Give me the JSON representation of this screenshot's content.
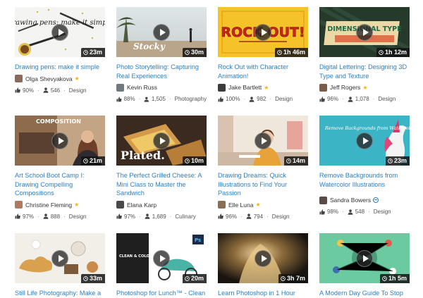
{
  "courses": [
    {
      "title": "Drawing pens: make it simple",
      "thumb_text": "Drawing pens: make it simple",
      "duration": "23m",
      "teacher": "Olga Shevyakova",
      "teacher_badge": "star",
      "rating": "90%",
      "students": "546",
      "category": "Design"
    },
    {
      "title": "Photo Storytelling: Capturing Real Experiences",
      "thumb_text": "Stocky",
      "duration": "30m",
      "teacher": "Kevin Russ",
      "teacher_badge": "",
      "rating": "88%",
      "students": "1,505",
      "category": "Photography"
    },
    {
      "title": "Rock Out with Character Animation!",
      "thumb_text": "ROCK OUT!",
      "duration": "1h 46m",
      "teacher": "Jake Bartlett",
      "teacher_badge": "star",
      "rating": "100%",
      "students": "982",
      "category": "Design"
    },
    {
      "title": "Digital Lettering: Designing 3D Type and Texture",
      "thumb_text": "DIMENSIONAL TYPE",
      "duration": "1h 12m",
      "teacher": "Jeff Rogers",
      "teacher_badge": "star",
      "rating": "96%",
      "students": "1,078",
      "category": "Design"
    },
    {
      "title": "Art School Boot Camp I: Drawing Compelling Compositions",
      "thumb_text": "COMPOSITION",
      "duration": "21m",
      "teacher": "Christine Fleming",
      "teacher_badge": "star",
      "rating": "97%",
      "students": "888",
      "category": "Design"
    },
    {
      "title": "The Perfect Grilled Cheese: A Mini Class to Master the Sandwich",
      "thumb_text": "Plated.",
      "duration": "10m",
      "teacher": "Elana Karp",
      "teacher_badge": "",
      "rating": "97%",
      "students": "1,689",
      "category": "Culinary"
    },
    {
      "title": "Drawing Dreams: Quick Illustrations to Find Your Passion",
      "thumb_text": "",
      "duration": "14m",
      "teacher": "Elle Luna",
      "teacher_badge": "star",
      "rating": "96%",
      "students": "794",
      "category": "Design"
    },
    {
      "title": "Remove Backgrounds from Watercolor Illustrations",
      "thumb_text": "Remove Backgrounds from Watercolor Illustrations",
      "duration": "23m",
      "teacher": "Sandra Bowers",
      "teacher_badge": "verified",
      "rating": "98%",
      "students": "548",
      "category": "Design"
    },
    {
      "title": "Still Life Photography: Make a",
      "thumb_text": "",
      "duration": "33m",
      "teacher": "",
      "teacher_badge": "",
      "rating": "",
      "students": "",
      "category": ""
    },
    {
      "title": "Photoshop for Lunch™ - Clean",
      "thumb_text": "CLEAN & COLOR SCANNED LINE ART",
      "duration": "20m",
      "teacher": "",
      "teacher_badge": "",
      "rating": "",
      "students": "",
      "category": ""
    },
    {
      "title": "Learn Photoshop in 1 Hour",
      "thumb_text": "",
      "duration": "3h 7m",
      "teacher": "",
      "teacher_badge": "",
      "rating": "",
      "students": "",
      "category": ""
    },
    {
      "title": "A Modern Day Guide To Stop",
      "thumb_text": "",
      "duration": "1h 5m",
      "teacher": "",
      "teacher_badge": "",
      "rating": "",
      "students": "",
      "category": ""
    }
  ],
  "colors": {
    "link": "#2f7fbf",
    "star": "#f5b30b"
  },
  "icons": {
    "play": "play-icon",
    "duration": "clock-icon",
    "rating": "thumbs-up-icon",
    "students": "person-icon",
    "star_badge": "star-icon",
    "verified_badge": "verified-icon"
  }
}
